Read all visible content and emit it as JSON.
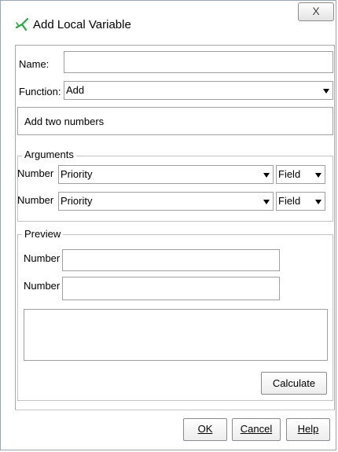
{
  "window": {
    "title": "Add Local Variable",
    "icon": "variable-x-icon",
    "close_glyph": "X"
  },
  "form": {
    "name_label": "Name:",
    "name_value": "",
    "function_label": "Function:",
    "function_value": "Add",
    "description": "Add two numbers"
  },
  "arguments": {
    "legend": "Arguments",
    "rows": [
      {
        "label": "Number",
        "value": "Priority",
        "type": "Field"
      },
      {
        "label": "Number",
        "value": "Priority",
        "type": "Field"
      }
    ]
  },
  "preview": {
    "legend": "Preview",
    "rows": [
      {
        "label": "Number",
        "value": ""
      },
      {
        "label": "Number",
        "value": ""
      }
    ],
    "result": "",
    "calculate_label": "Calculate"
  },
  "buttons": {
    "ok": "OK",
    "cancel": "Cancel",
    "help": "Help"
  },
  "colors": {
    "icon_green": "#2aa845",
    "border": "#a0a0a0"
  }
}
